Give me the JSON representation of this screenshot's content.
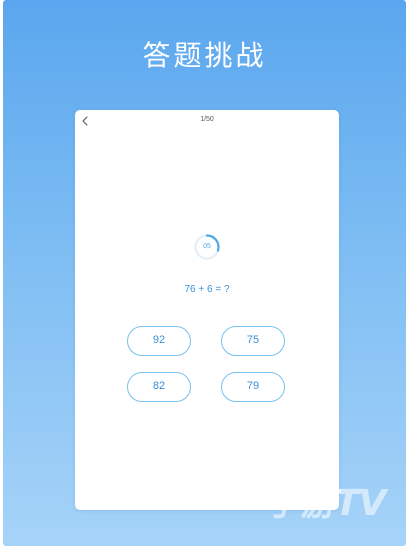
{
  "header": {
    "title": "答题挑战"
  },
  "card": {
    "back_icon": "chevron-left-icon",
    "progress": "1/50",
    "timer": {
      "value": "05",
      "ring_fraction": 0.3
    },
    "question": "76 + 6 = ?",
    "answers": [
      "92",
      "75",
      "82",
      "79"
    ]
  },
  "watermark": {
    "text": "手游TV"
  },
  "colors": {
    "background_top": "#5aa6ee",
    "background_bottom": "#a6d3f8",
    "accent": "#3a8fd6",
    "answer_border": "#78c2ee"
  }
}
